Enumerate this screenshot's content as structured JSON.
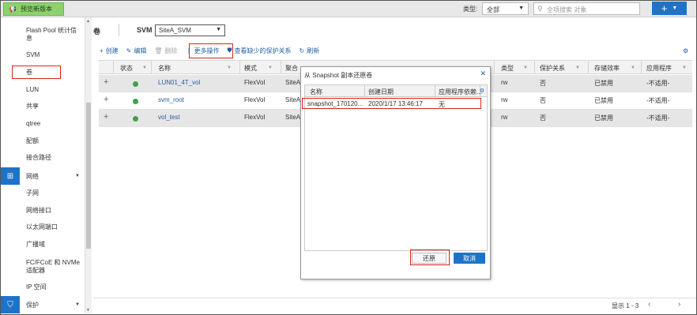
{
  "topbar": {
    "preview_label": "预览新版本",
    "type_label": "类型:",
    "type_value": "全部",
    "search_placeholder": "全项搜索 对象",
    "add_symbol": "+"
  },
  "sidebar": {
    "items_top": [
      "Flash Pool 统计信息",
      "SVM",
      "卷",
      "LUN",
      "共享",
      "qtree",
      "配额",
      "接合路径"
    ],
    "section_network": "网络",
    "network_items": [
      "子网",
      "网络接口",
      "以太网端口",
      "广播域",
      "FC/FCoE 和 NVMe 适配器",
      "IP 空间"
    ],
    "section_protection": "保护"
  },
  "main": {
    "title": "卷",
    "svm_label": "SVM",
    "svm_value": "SiteA_SVM"
  },
  "toolbar": {
    "create": "创建",
    "edit": "编辑",
    "delete": "删除",
    "more": "更多操作",
    "missing_protection": "查看缺少的保护关系",
    "refresh": "刷新"
  },
  "table": {
    "headers": [
      "状态",
      "名称",
      "模式",
      "聚合",
      "类型",
      "保护关系",
      "存储效率",
      "应用程序"
    ],
    "rows": [
      {
        "name": "LUN01_4T_vol",
        "mode": "FlexVol",
        "aggr": "SiteA",
        "type": "rw",
        "protection": "否",
        "efficiency": "已禁用",
        "app": "-不适用-"
      },
      {
        "name": "svm_root",
        "mode": "FlexVol",
        "aggr": "SiteA",
        "type": "rw",
        "protection": "否",
        "efficiency": "已禁用",
        "app": "-不适用-"
      },
      {
        "name": "vol_test",
        "mode": "FlexVol",
        "aggr": "SiteA",
        "type": "rw",
        "protection": "否",
        "efficiency": "已禁用",
        "app": "-不适用-"
      }
    ]
  },
  "status": {
    "pager_text": "显示 1 - 3"
  },
  "modal": {
    "title": "从 Snapshot 副本还原卷",
    "headers": [
      "名称",
      "创建日期",
      "应用程序依赖..."
    ],
    "row": {
      "name": "snapshot_170120...",
      "date": "2020/1/17 13:46:17",
      "dep": "无"
    },
    "ok_label": "还原",
    "cancel_label": "取消"
  },
  "colors": {
    "accent": "#1f73c7",
    "highlight": "#d9241c",
    "preview_green": "#8ed16f",
    "status_ok": "#3fa14a"
  }
}
